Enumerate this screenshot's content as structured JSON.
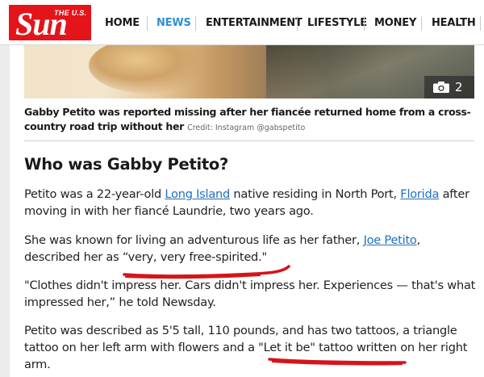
{
  "header": {
    "logo_small": "THE U.S.",
    "logo_main": "Sun",
    "nav": [
      "HOME",
      "NEWS",
      "ENTERTAINMENT",
      "LIFESTYLE",
      "MONEY",
      "HEALTH"
    ],
    "active_nav": "NEWS"
  },
  "hero": {
    "photo_count": "2",
    "caption": "Gabby Petito was reported missing after her fiancée returned home from a cross-country road trip without her",
    "credit": "Credit: Instagram @gabspetito"
  },
  "article": {
    "heading": "Who was Gabby Petito?",
    "p1": {
      "a": "Petito was a 22-year-old ",
      "link1": "Long Island",
      "b": " native residing in North Port, ",
      "link2": "Florida",
      "c": " after moving in with her fiancé Laundrie, two years ago."
    },
    "p2": {
      "a": "She was known for living an adventurous life as her father, ",
      "link1": "Joe Petito",
      "b": ", described her as “very, very free-spirited.\""
    },
    "p3": "\"Clothes didn't impress her. Cars didn't impress her. Experiences — that's what impressed her,” he told Newsday.",
    "p4": "Petito was described as 5'5 tall, 110 pounds, and has two tattoos, a triangle tattoo on her left arm with flowers and a \"Let it be\" tattoo written on her right arm."
  },
  "colors": {
    "brand_red": "#e4141b",
    "link_blue": "#1f6fbf",
    "active_nav_blue": "#2e8fd8",
    "annotation_red": "#d4151b"
  }
}
